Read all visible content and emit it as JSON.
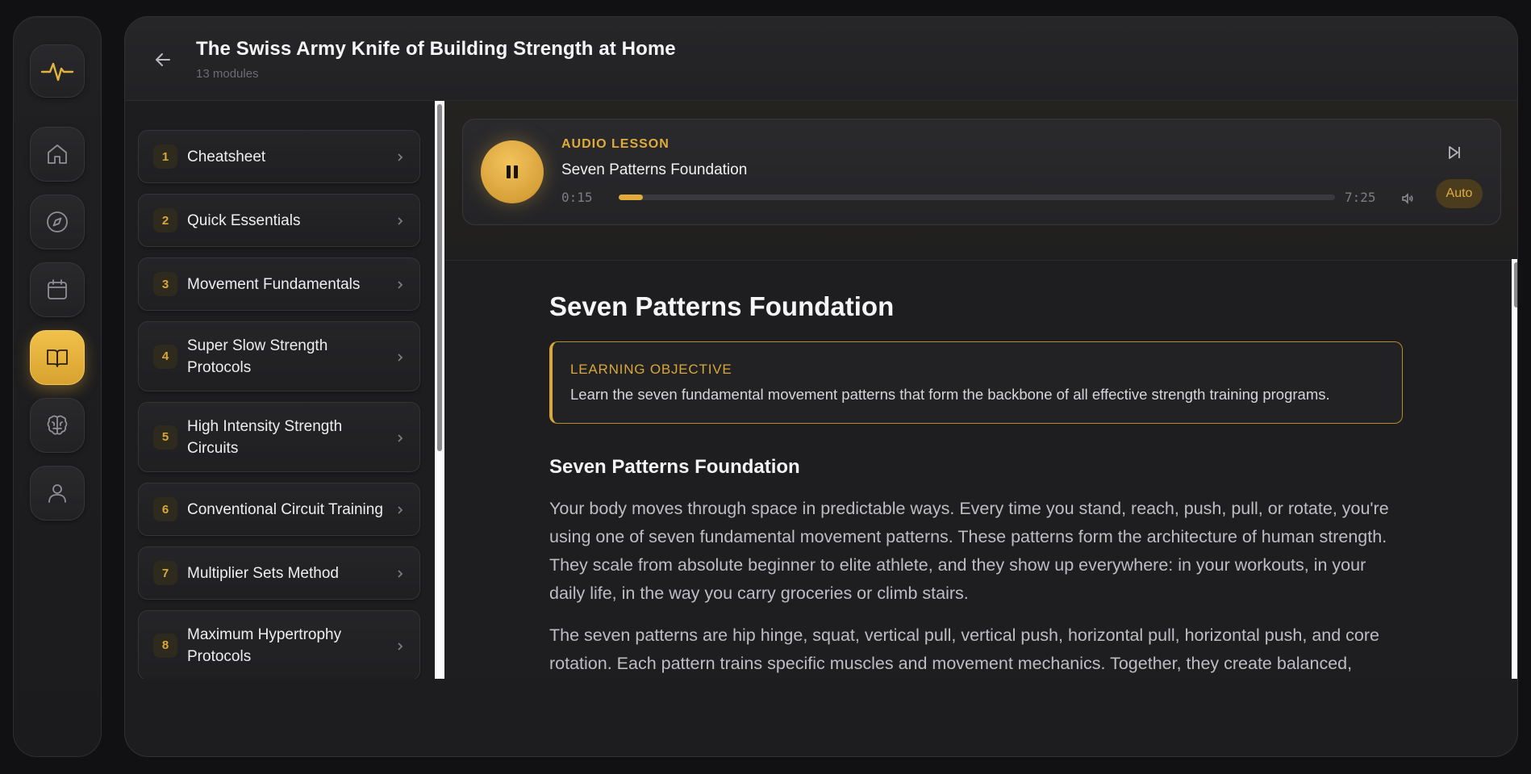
{
  "rail": {
    "items": [
      {
        "name": "home",
        "icon": "home-icon",
        "active": false
      },
      {
        "name": "explore",
        "icon": "compass-icon",
        "active": false
      },
      {
        "name": "calendar",
        "icon": "calendar-icon",
        "active": false
      },
      {
        "name": "library",
        "icon": "book-icon",
        "active": true
      },
      {
        "name": "mind",
        "icon": "brain-icon",
        "active": false
      },
      {
        "name": "profile",
        "icon": "user-icon",
        "active": false
      }
    ],
    "logo_icon": "heartbeat-icon"
  },
  "header": {
    "title": "The Swiss Army Knife of Building Strength at Home",
    "subtitle": "13 modules"
  },
  "modules": [
    {
      "num": "1",
      "label": "Cheatsheet"
    },
    {
      "num": "2",
      "label": "Quick Essentials"
    },
    {
      "num": "3",
      "label": "Movement Fundamentals"
    },
    {
      "num": "4",
      "label": "Super Slow Strength Protocols"
    },
    {
      "num": "5",
      "label": "High Intensity Strength Circuits"
    },
    {
      "num": "6",
      "label": "Conventional Circuit Training"
    },
    {
      "num": "7",
      "label": "Multiplier Sets Method"
    },
    {
      "num": "8",
      "label": "Maximum Hypertrophy Protocols"
    }
  ],
  "audio": {
    "kicker": "AUDIO LESSON",
    "title": "Seven Patterns Foundation",
    "current_time": "0:15",
    "total_time": "7:25",
    "progress": 0.034,
    "auto_label": "Auto"
  },
  "article": {
    "title": "Seven Patterns Foundation",
    "objective_label": "LEARNING OBJECTIVE",
    "objective_text": "Learn the seven fundamental movement patterns that form the backbone of all effective strength training programs.",
    "section_title": "Seven Patterns Foundation",
    "paragraphs": [
      "Your body moves through space in predictable ways. Every time you stand, reach, push, pull, or rotate, you're using one of seven fundamental movement patterns. These patterns form the architecture of human strength. They scale from absolute beginner to elite athlete, and they show up everywhere: in your workouts, in your daily life, in the way you carry groceries or climb stairs.",
      "The seven patterns are hip hinge, squat, vertical pull, vertical push, horizontal pull, horizontal push, and core rotation. Each pattern trains specific muscles and movement mechanics. Together, they create balanced,"
    ]
  },
  "colors": {
    "accent": "#e0ab3a",
    "background": "#111113",
    "panel": "#1d1d20"
  }
}
